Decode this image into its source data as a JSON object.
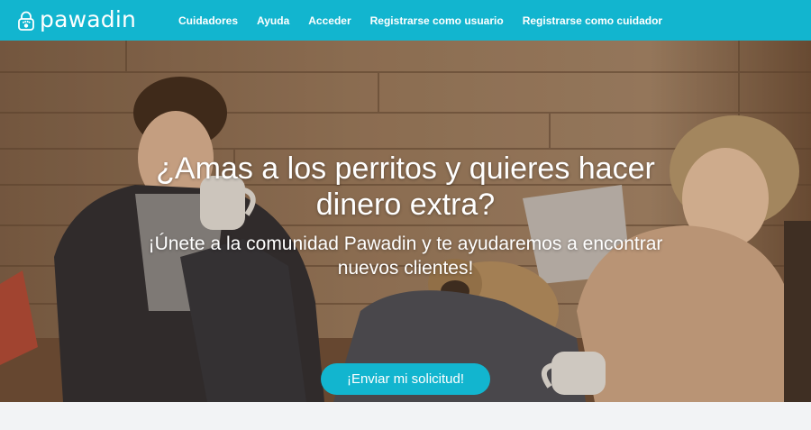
{
  "brand": {
    "name": "pawadin",
    "color": "#12b5cf"
  },
  "nav": {
    "items": [
      {
        "label": "Cuidadores"
      },
      {
        "label": "Ayuda"
      },
      {
        "label": "Acceder"
      },
      {
        "label": "Registrarse como usuario"
      },
      {
        "label": "Registrarse como cuidador"
      }
    ]
  },
  "hero": {
    "title": "¿Amas a los perritos y quieres hacer dinero extra?",
    "subtitle": "¡Únete a la comunidad Pawadin y te ayudaremos a encontrar nuevos clientes!",
    "cta_label": "¡Enviar mi solicitud!",
    "background": "photo-couple-with-pug-on-wooden-deck"
  }
}
